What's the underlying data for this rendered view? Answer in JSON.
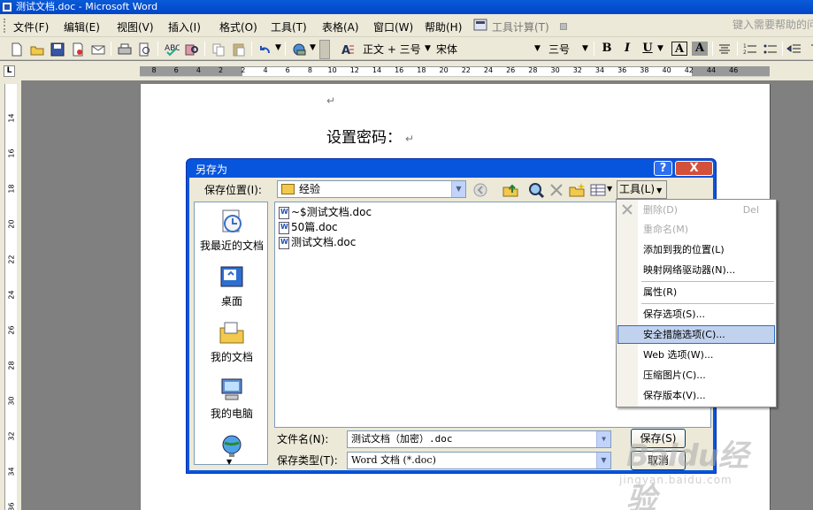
{
  "window": {
    "title": "测试文档.doc - Microsoft Word"
  },
  "menubar": {
    "items": [
      "文件(F)",
      "编辑(E)",
      "视图(V)",
      "插入(I)",
      "格式(O)",
      "工具(T)",
      "表格(A)",
      "窗口(W)",
      "帮助(H)"
    ],
    "tool_calc": "工具计算(T)",
    "help_box": "键入需要帮助的问"
  },
  "toolbar": {
    "style": "正文 + 三号",
    "font": "宋体",
    "size": "三号",
    "bold": "B",
    "italic": "I",
    "underline": "U",
    "charbox": "A",
    "charshade": "A"
  },
  "ruler": {
    "corner": "L",
    "ticks": [
      "8",
      "6",
      "4",
      "2",
      "2",
      "4",
      "6",
      "8",
      "10",
      "12",
      "14",
      "16",
      "18",
      "20",
      "22",
      "24",
      "26",
      "28",
      "30",
      "32",
      "34",
      "36",
      "38",
      "40",
      "42",
      "44",
      "46"
    ],
    "vticks": [
      "14",
      "16",
      "18",
      "20",
      "22",
      "24",
      "26",
      "28",
      "30",
      "32",
      "34",
      "36"
    ]
  },
  "document": {
    "heading": "设置密码：",
    "para_mark": "↵"
  },
  "dialog": {
    "title": "另存为",
    "help": "?",
    "close": "X",
    "save_in_label": "保存位置(I):",
    "save_in_value": "经验",
    "tools_button": "工具(L)",
    "places": [
      "我最近的文档",
      "桌面",
      "我的文档",
      "我的电脑"
    ],
    "files": [
      "~$测试文档.doc",
      "50篇.doc",
      "测试文档.doc"
    ],
    "filename_label": "文件名(N):",
    "filename_value": "测试文档（加密）.doc",
    "filetype_label": "保存类型(T):",
    "filetype_value": "Word 文档 (*.doc)",
    "save_button": "保存(S)",
    "cancel_button": "取消"
  },
  "tools_menu": {
    "items": [
      {
        "label": "删除(D)",
        "shortcut": "Del",
        "enabled": false
      },
      {
        "label": "重命名(M)",
        "shortcut": "",
        "enabled": false
      },
      {
        "label": "添加到我的位置(L)",
        "shortcut": "",
        "enabled": true
      },
      {
        "label": "映射网络驱动器(N)...",
        "shortcut": "",
        "enabled": true
      },
      {
        "label": "属性(R)",
        "shortcut": "",
        "enabled": true
      },
      {
        "label": "保存选项(S)...",
        "shortcut": "",
        "enabled": true
      },
      {
        "label": "安全措施选项(C)...",
        "shortcut": "",
        "enabled": true,
        "highlighted": true
      },
      {
        "label": "Web 选项(W)...",
        "shortcut": "",
        "enabled": true
      },
      {
        "label": "压缩图片(C)...",
        "shortcut": "",
        "enabled": true
      },
      {
        "label": "保存版本(V)...",
        "shortcut": "",
        "enabled": true
      }
    ]
  },
  "watermark": {
    "logo": "Baidu经验",
    "url": "jingyan.baidu.com"
  }
}
